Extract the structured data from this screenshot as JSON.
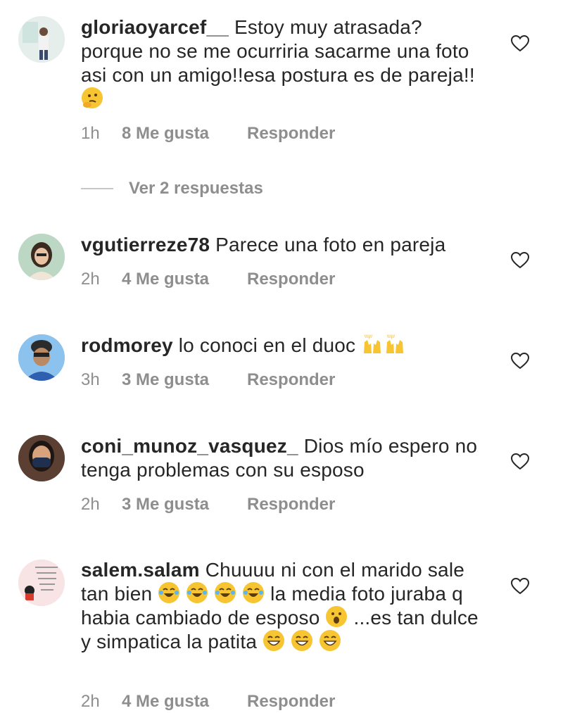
{
  "comments": [
    {
      "username": "gloriaoyarcef__",
      "text": "Estoy muy atrasada? porque no se me ocurriria sacarme una foto asi con un amigo!!esa postura es de pareja!!",
      "emoji": "thinking-face",
      "time": "1h",
      "likes": "8 Me gusta",
      "reply": "Responder"
    },
    {
      "username": "vgutierreze78",
      "text": "Parece una foto en pareja",
      "time": "2h",
      "likes": "4 Me gusta",
      "reply": "Responder"
    },
    {
      "username": "rodmorey",
      "text": "lo  conoci en el duoc",
      "emoji": "raising-hands",
      "time": "3h",
      "likes": "3 Me gusta",
      "reply": "Responder"
    },
    {
      "username": "coni_munoz_vasquez_",
      "text": "Dios mío espero no tenga problemas con su esposo",
      "time": "2h",
      "likes": "3 Me gusta",
      "reply": "Responder"
    },
    {
      "username": "salem.salam",
      "text_part1": "Chuuuu ni con el marido sale tan bien",
      "text_part2": "la media  foto juraba q habia cambiado de esposo",
      "text_part3": "...es tan dulce y simpatica la patita",
      "avatar_text": "Tomar distancia y dejarse de personas complicadas mejora la salud!",
      "time": "2h",
      "likes": "4 Me gusta",
      "reply": "Responder"
    }
  ],
  "view_replies": "Ver 2 respuestas",
  "colors": {
    "text": "#262626",
    "muted": "#8e8e8e",
    "emoji": "#f7c531"
  }
}
